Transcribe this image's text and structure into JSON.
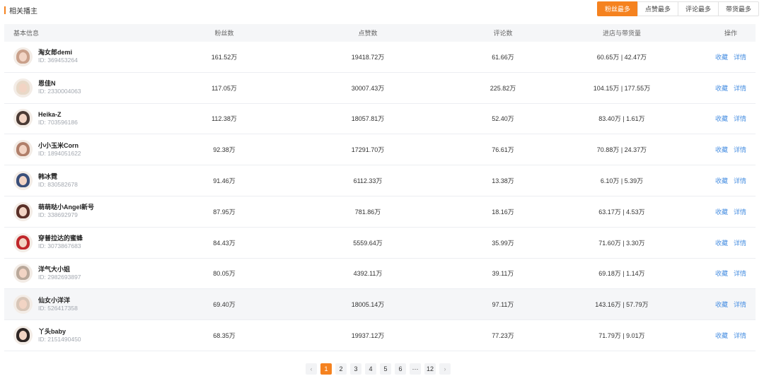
{
  "section_title": "相关播主",
  "sort_tabs": [
    "粉丝最多",
    "点赞最多",
    "评论最多",
    "带货最多"
  ],
  "columns": {
    "info": "基本信息",
    "fans": "粉丝数",
    "likes": "点赞数",
    "comments": "评论数",
    "sales": "进店与带货量",
    "ops": "操作"
  },
  "id_prefix": "ID:",
  "op_labels": {
    "favorite": "收藏",
    "detail": "详情"
  },
  "rows": [
    {
      "name": "淘女郎demi",
      "id": "369453264",
      "fans": "161.52万",
      "likes": "19418.72万",
      "comments": "61.66万",
      "sales": "60.65万 | 42.47万",
      "avatar_color": "#c9a08a"
    },
    {
      "name": "恩佳N",
      "id": "2330004063",
      "fans": "117.05万",
      "likes": "30007.43万",
      "comments": "225.82万",
      "sales": "104.15万 | 177.55万",
      "avatar_color": "#e8d9c8"
    },
    {
      "name": "Heika-Z",
      "id": "703596186",
      "fans": "112.38万",
      "likes": "18057.81万",
      "comments": "52.40万",
      "sales": "83.40万 | 1.61万",
      "avatar_color": "#4a3a34"
    },
    {
      "name": "小小玉米Corn",
      "id": "1894051622",
      "fans": "92.38万",
      "likes": "17291.70万",
      "comments": "76.61万",
      "sales": "70.88万 | 24.37万",
      "avatar_color": "#b07f6a"
    },
    {
      "name": "韩冰霓",
      "id": "830582678",
      "fans": "91.46万",
      "likes": "6112.33万",
      "comments": "13.38万",
      "sales": "6.10万 | 5.39万",
      "avatar_color": "#3a4f7a"
    },
    {
      "name": "萌萌哒小Angel新号",
      "id": "338692979",
      "fans": "87.95万",
      "likes": "781.86万",
      "comments": "18.16万",
      "sales": "63.17万 | 4.53万",
      "avatar_color": "#5a3028"
    },
    {
      "name": "穿普拉达的蜜蜂",
      "id": "3073867683",
      "fans": "84.43万",
      "likes": "5559.64万",
      "comments": "35.99万",
      "sales": "71.60万 | 3.30万",
      "avatar_color": "#c0262a"
    },
    {
      "name": "洋气大小姐",
      "id": "2982693897",
      "fans": "80.05万",
      "likes": "4392.11万",
      "comments": "39.11万",
      "sales": "69.18万 | 1.14万",
      "avatar_color": "#b9a89a"
    },
    {
      "name": "仙女小洋洋",
      "id": "526417358",
      "fans": "69.40万",
      "likes": "18005.14万",
      "comments": "97.11万",
      "sales": "143.16万 | 57.79万",
      "avatar_color": "#d8c6b8"
    },
    {
      "name": "丫头baby",
      "id": "2151490450",
      "fans": "68.35万",
      "likes": "19937.12万",
      "comments": "77.23万",
      "sales": "71.79万 | 9.01万",
      "avatar_color": "#2e2624"
    }
  ],
  "highlight_row": 8,
  "pagination": {
    "pages": [
      "1",
      "2",
      "3",
      "4",
      "5",
      "6",
      "···",
      "12"
    ],
    "current": "1",
    "prev": "‹",
    "next": "›"
  },
  "colors": {
    "accent": "#f5821f",
    "link": "#4a90e2"
  }
}
